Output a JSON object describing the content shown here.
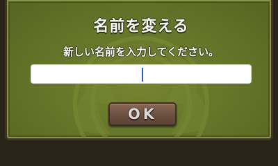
{
  "dialog": {
    "title": "名前を変える",
    "prompt": "新しい名前を入力してください。",
    "name_field": {
      "value": "",
      "placeholder": ""
    },
    "ok_label": "OK"
  },
  "colors": {
    "panel_green": "#66762a",
    "button_brown": "#6e5142",
    "caret_blue": "#2a5bd7"
  }
}
